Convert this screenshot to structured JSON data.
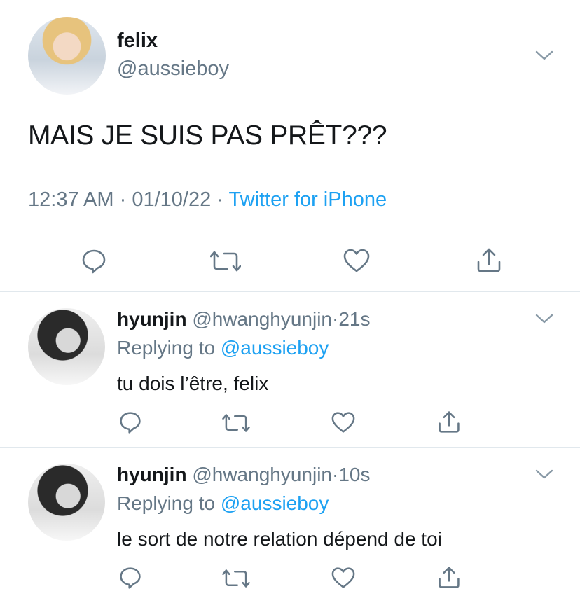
{
  "main_tweet": {
    "display_name": "felix",
    "handle": "@aussieboy",
    "text": "MAIS JE SUIS PAS PRÊT???",
    "time": "12:37 AM",
    "sep1": " · ",
    "date": "01/10/22",
    "sep2": " · ",
    "source": "Twitter for iPhone"
  },
  "replies": [
    {
      "display_name": "hyunjin",
      "handle": "@hwanghyunjin",
      "dot": "·",
      "time": "21s",
      "replying_prefix": "Replying to ",
      "replying_to": "@aussieboy",
      "text": "tu dois l’être, felix"
    },
    {
      "display_name": "hyunjin",
      "handle": "@hwanghyunjin",
      "dot": "·",
      "time": "10s",
      "replying_prefix": "Replying to ",
      "replying_to": "@aussieboy",
      "text": "le sort de notre relation dépend de toi"
    }
  ],
  "icons": {
    "reply": "speech-bubble-icon",
    "retweet": "retweet-icon",
    "like": "heart-icon",
    "share": "share-icon",
    "more": "chevron-down-icon"
  },
  "colors": {
    "link": "#1da1f2",
    "secondary_text": "#657786",
    "primary_text": "#14171a",
    "icon": "#657786",
    "divider": "#e1e8ed"
  }
}
